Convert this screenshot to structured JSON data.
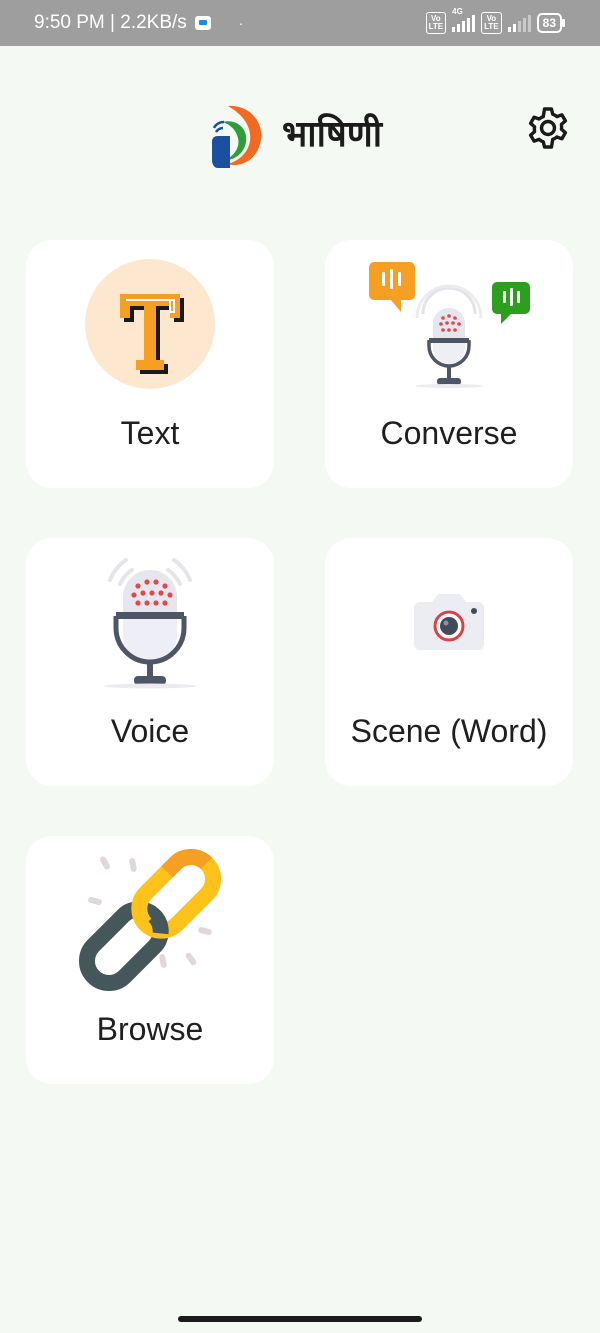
{
  "status_bar": {
    "time_speed": "9:50 PM | 2.2KB/s",
    "dot": "·",
    "volte1": "Vo\nLTE",
    "net1": "4G",
    "volte2": "Vo\nLTE",
    "battery": "83"
  },
  "header": {
    "title": "भाषिणी",
    "logo_icon": "bhashini-logo-icon",
    "settings_icon": "gear-icon"
  },
  "features": {
    "text": {
      "label": "Text",
      "icon": "text-t-icon"
    },
    "converse": {
      "label": "Converse",
      "icon": "conversation-mic-icon"
    },
    "voice": {
      "label": "Voice",
      "icon": "microphone-icon"
    },
    "scene": {
      "label": "Scene (Word)",
      "icon": "camera-icon"
    },
    "browse": {
      "label": "Browse",
      "icon": "link-icon"
    }
  },
  "colors": {
    "background": "#f5f9f3",
    "card": "#ffffff",
    "accent_orange": "#f5a023",
    "accent_green": "#2e9e1f",
    "mic_dots": "#e0484a"
  }
}
